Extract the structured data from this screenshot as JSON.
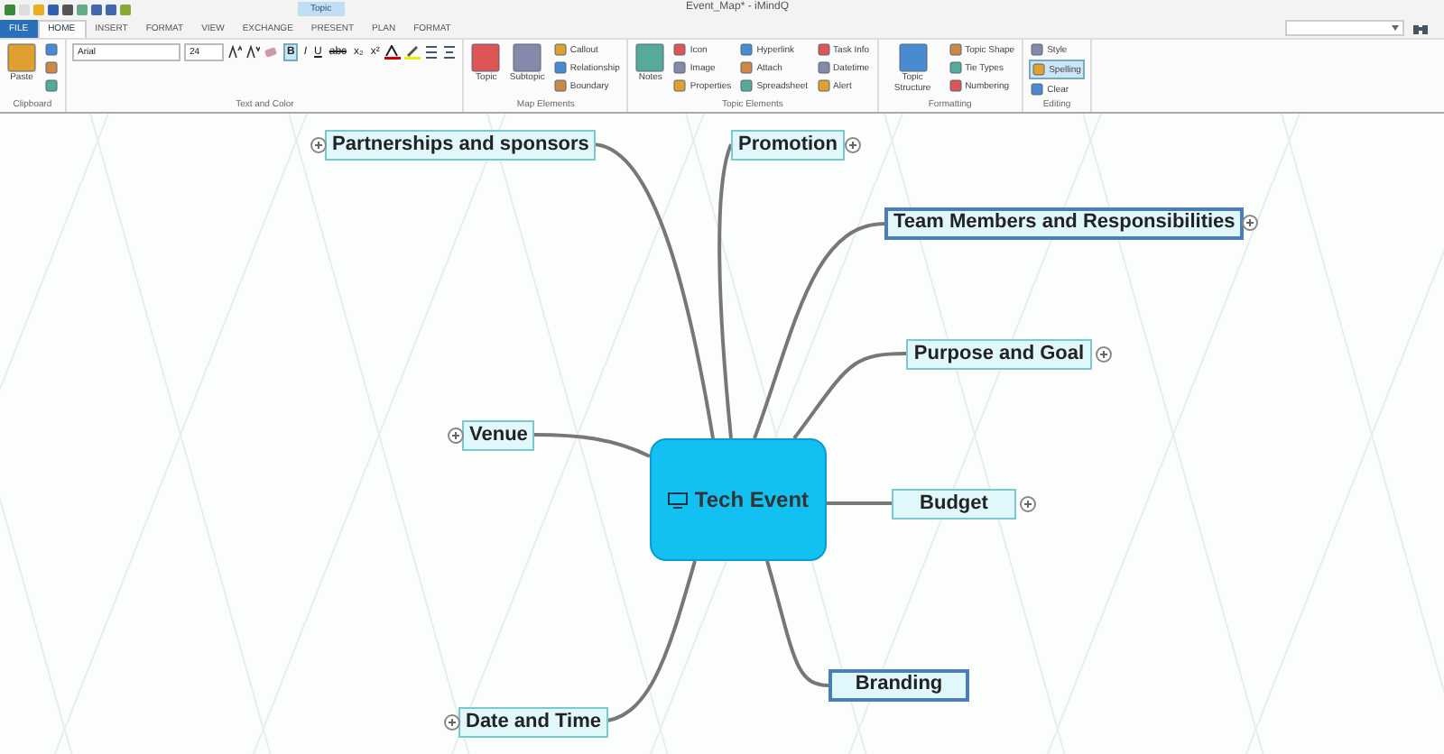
{
  "window": {
    "title": "Event_Map* - iMindQ",
    "context_tab": "Topic"
  },
  "tabs": [
    {
      "label": "FILE",
      "kind": "file",
      "selected": false
    },
    {
      "label": "HOME",
      "kind": "tab",
      "selected": true
    },
    {
      "label": "INSERT",
      "kind": "tab",
      "selected": false
    },
    {
      "label": "FORMAT",
      "kind": "tab",
      "selected": false
    },
    {
      "label": "VIEW",
      "kind": "tab",
      "selected": false
    },
    {
      "label": "EXCHANGE",
      "kind": "tab",
      "selected": false
    },
    {
      "label": "PRESENT",
      "kind": "tab",
      "selected": false
    },
    {
      "label": "PLAN",
      "kind": "tab",
      "selected": false
    },
    {
      "label": "FORMAT",
      "kind": "tab",
      "selected": false
    }
  ],
  "ribbon": [
    {
      "label": "Clipboard",
      "kind": "buttons",
      "columns": [
        [
          {
            "label": "Paste",
            "kind": "large",
            "selected": false
          }
        ],
        [
          {
            "kind": "small",
            "selected": false
          },
          {
            "kind": "small",
            "selected": false
          },
          {
            "kind": "small",
            "selected": false
          }
        ]
      ]
    },
    {
      "label": "Text and Color",
      "kind": "font",
      "font_name": "Arial",
      "font_size": "24",
      "format_buttons": [
        {
          "label": "B",
          "selected": true
        },
        {
          "label": "I",
          "selected": false
        },
        {
          "label": "U",
          "selected": false
        },
        {
          "label": "abc",
          "selected": false
        },
        {
          "label": "x₂",
          "selected": false
        },
        {
          "label": "x²",
          "selected": false
        }
      ]
    },
    {
      "label": "Map Elements",
      "kind": "buttons",
      "columns": [
        [
          {
            "label": "Topic",
            "kind": "large",
            "selected": false
          }
        ],
        [
          {
            "label": "Subtopic",
            "kind": "large",
            "selected": false
          }
        ],
        [
          {
            "label": "Callout",
            "kind": "small",
            "selected": false
          },
          {
            "label": "Relationship",
            "kind": "small",
            "selected": false
          },
          {
            "label": "Boundary",
            "kind": "small",
            "selected": false
          }
        ]
      ]
    },
    {
      "label": "Topic Elements",
      "kind": "buttons",
      "columns": [
        [
          {
            "label": "Notes",
            "kind": "large",
            "selected": false
          }
        ],
        [
          {
            "label": "Icon",
            "kind": "small",
            "selected": false
          },
          {
            "label": "Image",
            "kind": "small",
            "selected": false
          },
          {
            "label": "Properties",
            "kind": "small",
            "selected": false
          }
        ],
        [
          {
            "label": "Hyperlink",
            "kind": "small",
            "selected": false
          },
          {
            "label": "Attach",
            "kind": "small",
            "selected": false
          },
          {
            "label": "Spreadsheet",
            "kind": "small",
            "selected": false
          }
        ],
        [
          {
            "label": "Task Info",
            "kind": "small",
            "selected": false
          },
          {
            "label": "Datetime",
            "kind": "small",
            "selected": false
          },
          {
            "label": "Alert",
            "kind": "small",
            "selected": false
          }
        ]
      ]
    },
    {
      "label": "Formatting",
      "kind": "buttons",
      "columns": [
        [
          {
            "label": "Topic Structure",
            "kind": "large",
            "selected": false
          }
        ],
        [
          {
            "label": "Topic Shape",
            "kind": "small",
            "selected": false
          },
          {
            "label": "Tie Types",
            "kind": "small",
            "selected": false
          },
          {
            "label": "Numbering",
            "kind": "small",
            "selected": false
          }
        ]
      ]
    },
    {
      "label": "Editing",
      "kind": "buttons",
      "columns": [
        [
          {
            "label": "Style",
            "kind": "small",
            "selected": false
          },
          {
            "label": "Spelling",
            "kind": "small",
            "selected": true
          },
          {
            "label": "Clear",
            "kind": "small",
            "selected": false
          }
        ]
      ]
    }
  ],
  "map": {
    "central": {
      "label": "Tech Event"
    },
    "topics": [
      {
        "label": "Partnerships and sponsors",
        "selected": false,
        "collapsed": true
      },
      {
        "label": "Promotion",
        "selected": false,
        "collapsed": true
      },
      {
        "label": "Team Members and Responsibilities",
        "selected": true,
        "collapsed": true
      },
      {
        "label": "Purpose and Goal",
        "selected": false,
        "collapsed": true
      },
      {
        "label": "Venue",
        "selected": false,
        "collapsed": true
      },
      {
        "label": "Budget",
        "selected": false,
        "collapsed": true
      },
      {
        "label": "Branding",
        "selected": true,
        "collapsed": false
      },
      {
        "label": "Date and Time",
        "selected": false,
        "collapsed": true
      }
    ]
  }
}
